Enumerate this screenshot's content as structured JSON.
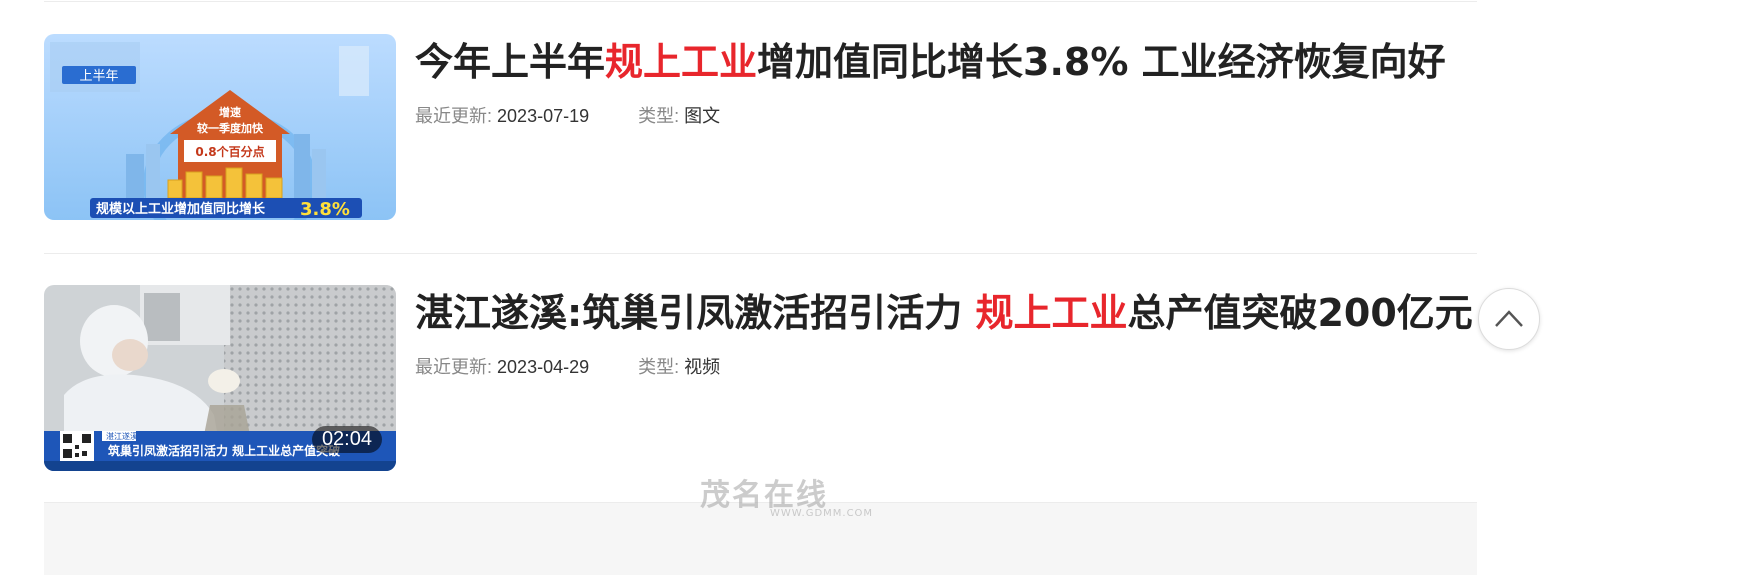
{
  "articles": [
    {
      "title_pre": "今年上半年",
      "title_highlight": "规上工业",
      "title_post": "增加值同比增长3.8% 工业经济恢复向好",
      "updated_label": "最近更新:",
      "updated_value": "2023-07-19",
      "type_label": "类型:",
      "type_value": "图文",
      "thumb": {
        "tag": "上半年",
        "house_line1": "增速",
        "house_line2": "较一季度加快",
        "house_line3": "0.8个百分点",
        "caption_text": "规模以上工业增加值同比增长",
        "caption_value": "3.8%"
      }
    },
    {
      "title_pre": "湛江遂溪:筑巢引凤激活招引活力 ",
      "title_highlight": "规上工业",
      "title_post": "总产值突破200亿元",
      "updated_label": "最近更新:",
      "updated_value": "2023-04-29",
      "type_label": "类型:",
      "type_value": "视频",
      "duration": "02:04",
      "thumb": {
        "news_tag": "湛江遂溪",
        "caption": "筑巢引凤激活招引活力 规上工业总产值突破"
      }
    }
  ],
  "watermark": {
    "text": "茂名在线",
    "url": "WWW.GDMM.COM"
  },
  "colors": {
    "highlight": "#e8262c",
    "title": "#222222",
    "meta_label": "#888888"
  },
  "icons": {
    "back_to_top": "chevron-up-icon"
  }
}
